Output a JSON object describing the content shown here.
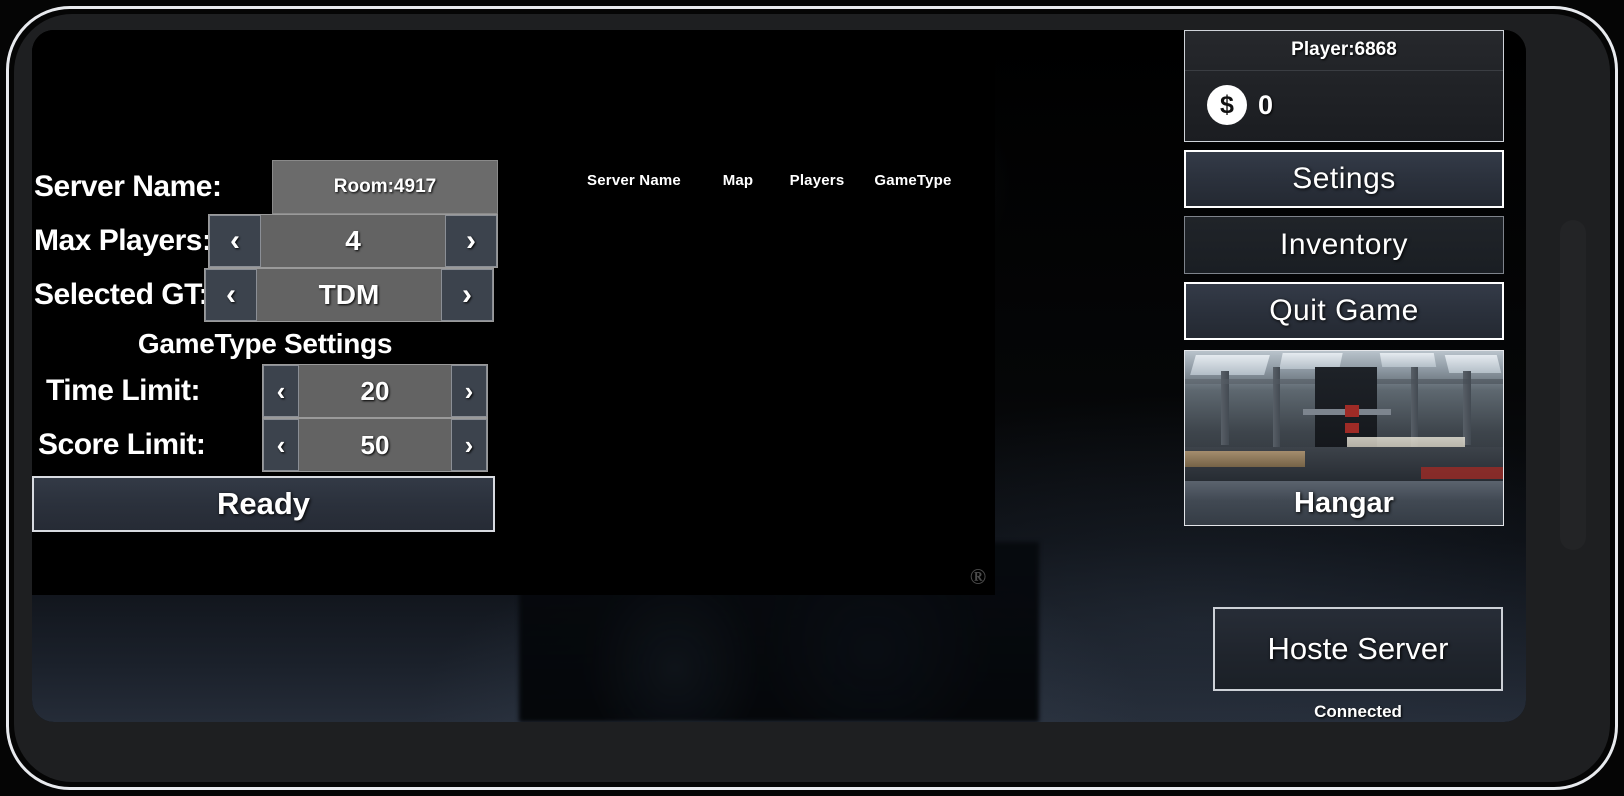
{
  "screen": {
    "background_scene": "dark-soldier-helmet-artwork",
    "watermark": "®"
  },
  "server_list": {
    "columns": [
      "Server Name",
      "Map",
      "Players",
      "GameType"
    ]
  },
  "settings_panel": {
    "server_name": {
      "label": "Server Name:",
      "value": "Room:4917"
    },
    "max_players": {
      "label": "Max Players:",
      "value": "4",
      "prev_icon": "‹",
      "next_icon": "›"
    },
    "selected_gametype": {
      "label": "Selected GT:",
      "value": "TDM",
      "prev_icon": "‹",
      "next_icon": "›"
    },
    "gametype_settings_title": "GameType Settings",
    "time_limit": {
      "label": "Time Limit:",
      "value": "20",
      "prev_icon": "‹",
      "next_icon": "›"
    },
    "score_limit": {
      "label": "Score Limit:",
      "value": "50",
      "prev_icon": "‹",
      "next_icon": "›"
    },
    "ready_button": "Ready"
  },
  "sidebar": {
    "player_name": "Player:6868",
    "currency": {
      "icon": "$",
      "amount": "0"
    },
    "menu": [
      {
        "label": "Setings"
      },
      {
        "label": "Inventory"
      },
      {
        "label": "Quit Game"
      }
    ],
    "map_card": {
      "name": "Hangar"
    },
    "host_button": "Hoste Server",
    "connection_status": "Connected"
  },
  "colors": {
    "accent_border": "#ffffff",
    "button_fill": "#2e3441",
    "value_fill": "#636363",
    "arrow_fill": "#3c434d"
  }
}
